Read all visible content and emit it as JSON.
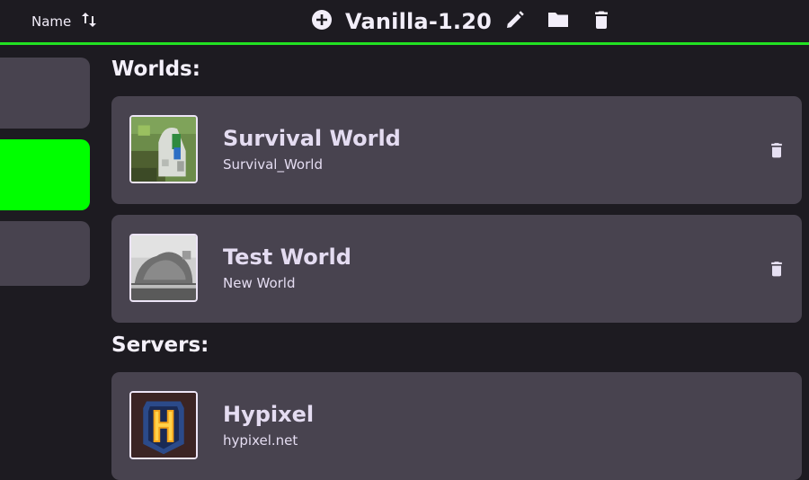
{
  "header": {
    "sort_label": "Name",
    "title": "Vanilla-1.20"
  },
  "sections": {
    "worlds_title": "Worlds:",
    "servers_title": "Servers:"
  },
  "worlds": [
    {
      "name": "Survival World",
      "folder": "Survival_World"
    },
    {
      "name": "Test World",
      "folder": "New World"
    }
  ],
  "servers": [
    {
      "name": "Hypixel",
      "address": "hypixel.net"
    }
  ],
  "colors": {
    "accent": "#22e222",
    "active_tile": "#00ff00",
    "card_bg": "#48434f",
    "page_bg": "#1d1b21"
  },
  "icons": [
    "sort-icon",
    "add-icon",
    "edit-icon",
    "folder-icon",
    "trash-icon"
  ]
}
